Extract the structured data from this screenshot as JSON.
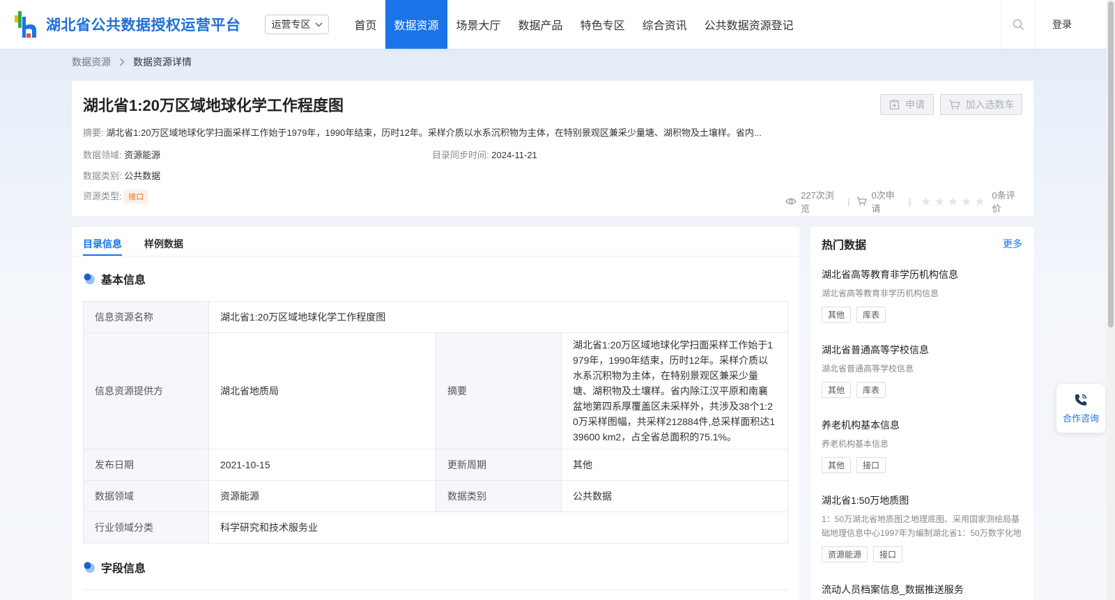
{
  "header": {
    "logo_text": "湖北省公共数据授权运营平台",
    "region_select": "运营专区",
    "nav": [
      "首页",
      "数据资源",
      "场景大厅",
      "数据产品",
      "特色专区",
      "综合资讯",
      "公共数据资源登记"
    ],
    "active_nav": 1,
    "login": "登录"
  },
  "breadcrumb": {
    "parent": "数据资源",
    "current": "数据资源详情"
  },
  "detail": {
    "title": "湖北省1:20万区域地球化学工作程度图",
    "apply_label": "申请",
    "cart_label": "加入选数车",
    "summary_label": "摘要:",
    "summary": "湖北省1:20万区域地球化学扫面采样工作始于1979年，1990年结束，历时12年。采样介质以水系沉积物为主体，在特别景观区兼采少量塘、湖积物及土壤样。省内...",
    "domain_label": "数据领域:",
    "domain": "资源能源",
    "sync_label": "目录同步时间:",
    "sync_time": "2024-11-21",
    "category_label": "数据类别:",
    "category": "公共数据",
    "type_label": "资源类型:",
    "type": "接口",
    "views": "227次浏览",
    "applies": "0次申请",
    "reviews": "0条评价",
    "rating": 0
  },
  "tabs": [
    "目录信息",
    "样例数据"
  ],
  "sections": {
    "basic": "基本信息",
    "fields": "字段信息"
  },
  "info": {
    "name_k": "信息资源名称",
    "name_v": "湖北省1:20万区域地球化学工作程度图",
    "provider_k": "信息资源提供方",
    "provider_v": "湖北省地质局",
    "abstract_k": "摘要",
    "abstract_v": "湖北省1:20万区域地球化学扫面采样工作始于1979年，1990年结束，历时12年。采样介质以水系沉积物为主体，在特别景观区兼采少量塘、湖积物及土壤样。省内除江汉平原和南襄盆地第四系厚覆盖区未采样外，共涉及38个1:20万采样图幅，共采样212884件,总采样面积达139600 km2，占全省总面积的75.1%。",
    "publish_k": "发布日期",
    "publish_v": "2021-10-15",
    "cycle_k": "更新周期",
    "cycle_v": "其他",
    "domain_k": "数据领域",
    "domain_v": "资源能源",
    "category_k": "数据类别",
    "category_v": "公共数据",
    "industry_k": "行业领域分类",
    "industry_v": "科学研究和技术服务业"
  },
  "hot": {
    "title": "热门数据",
    "more": "更多",
    "items": [
      {
        "name": "湖北省高等教育非学历机构信息",
        "desc": "湖北省高等教育非学历机构信息",
        "tags": [
          "其他",
          "库表"
        ]
      },
      {
        "name": "湖北省普通高等学校信息",
        "desc": "湖北省普通高等学校信息",
        "tags": [
          "其他",
          "库表"
        ]
      },
      {
        "name": "养老机构基本信息",
        "desc": "养老机构基本信息",
        "tags": [
          "其他",
          "接口"
        ]
      },
      {
        "name": "湖北省1:50万地质图",
        "desc": "1：50万湖北省地质图之地理底图、采用国家测绘局基础地理信息中心1997年为编制湖北省1：50万数字化地",
        "tags": [
          "资源能源",
          "接口"
        ]
      },
      {
        "name": "流动人员档案信息_数据推送服务",
        "desc": "",
        "tags": []
      }
    ]
  },
  "consult": "合作咨询",
  "colors": {
    "primary": "#1a73e8",
    "tag_orange": "#e8772e"
  }
}
